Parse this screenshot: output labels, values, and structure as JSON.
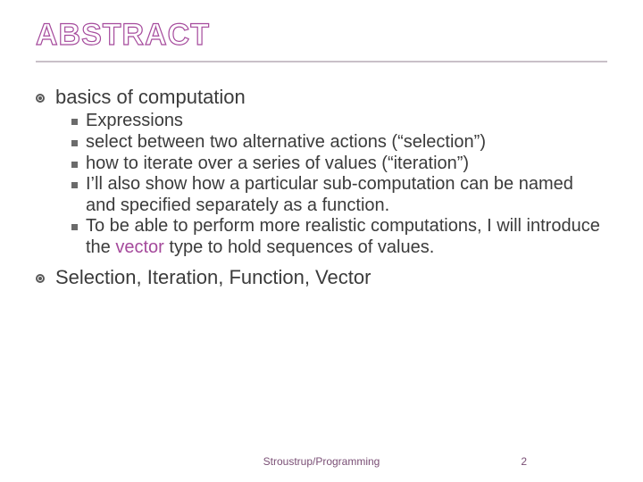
{
  "title": "ABSTRACT",
  "bullets": {
    "b1": "basics of computation",
    "sub": {
      "s1": "Expressions",
      "s2": "select between two alternative actions (“selection”)",
      "s3": "how to iterate over a series of values (“iteration”)",
      "s4": "I’ll also show how a particular sub-computation can be named and specified separately as a function.",
      "s5_a": "To be able to perform more realistic computations, I will introduce the ",
      "s5_kw": "vector",
      "s5_b": " type to hold sequences of values."
    },
    "b2": "Selection, Iteration, Function, Vector"
  },
  "footer": {
    "center": "Stroustrup/Programming",
    "page": "2"
  }
}
